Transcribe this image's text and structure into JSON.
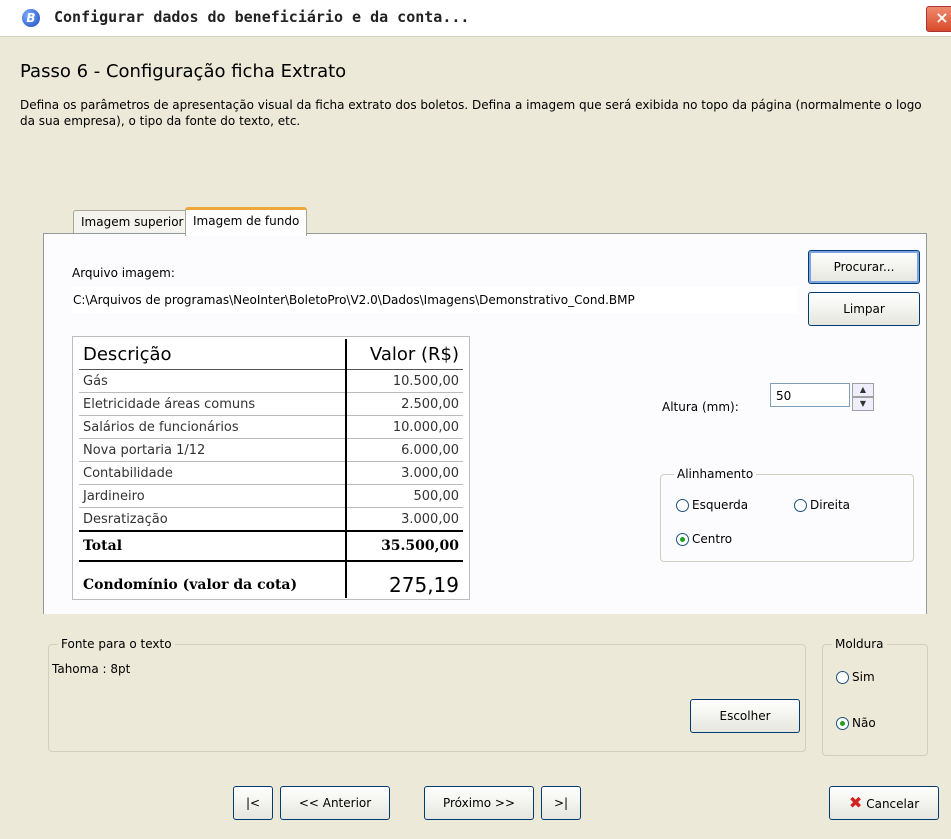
{
  "window": {
    "icon": "app-b-icon",
    "title": "Configurar dados do beneficiário e da conta...",
    "close_glyph": "×"
  },
  "step": {
    "title": "Passo 6 - Configuração ficha Extrato",
    "description": "Defina os parâmetros de apresentação visual da ficha extrato dos boletos. Defina a imagem que será exibida no topo da página (normalmente o logo da sua empresa), o tipo da fonte do texto, etc."
  },
  "tabs": [
    {
      "label": "Imagem superior",
      "active": false
    },
    {
      "label": "Imagem de fundo",
      "active": true
    }
  ],
  "image": {
    "label": "Arquivo imagem:",
    "path": "C:\\Arquivos de programas\\NeoInter\\BoletoPro\\V2.0\\Dados\\Imagens\\Demonstrativo_Cond.BMP",
    "browse_label": "Procurar...",
    "clear_label": "Limpar"
  },
  "preview": {
    "header": [
      "Descrição",
      "Valor (R$)"
    ],
    "rows": [
      [
        "Gás",
        "10.500,00"
      ],
      [
        "Eletricidade áreas comuns",
        "2.500,00"
      ],
      [
        "Salários de funcionários",
        "10.000,00"
      ],
      [
        "Nova portaria 1/12",
        "6.000,00"
      ],
      [
        "Contabilidade",
        "3.000,00"
      ],
      [
        "Jardineiro",
        "500,00"
      ],
      [
        "Desratização",
        "3.000,00"
      ]
    ],
    "total": [
      "Total",
      "35.500,00"
    ],
    "cota": [
      "Condomínio (valor da cota)",
      "275,19"
    ]
  },
  "height": {
    "label": "Altura (mm):",
    "value": "50"
  },
  "alignment": {
    "legend": "Alinhamento",
    "options": [
      {
        "label": "Esquerda",
        "selected": false
      },
      {
        "label": "Direita",
        "selected": false
      },
      {
        "label": "Centro",
        "selected": true
      }
    ]
  },
  "font": {
    "legend": "Fonte para o texto",
    "value": "Tahoma : 8pt",
    "choose_label": "Escolher"
  },
  "frame": {
    "legend": "Moldura",
    "options": [
      {
        "label": "Sim",
        "selected": false
      },
      {
        "label": "Não",
        "selected": true
      }
    ]
  },
  "nav": {
    "first_label": "|<",
    "prev_label": "<< Anterior",
    "next_label": "Próximo >>",
    "last_label": ">|",
    "cancel_label": "Cancelar"
  },
  "colors": {
    "background": "#ece9d8",
    "tab_highlight": "#f0a73a",
    "radio_selected": "#21a121",
    "cancel_icon": "#d32020"
  }
}
